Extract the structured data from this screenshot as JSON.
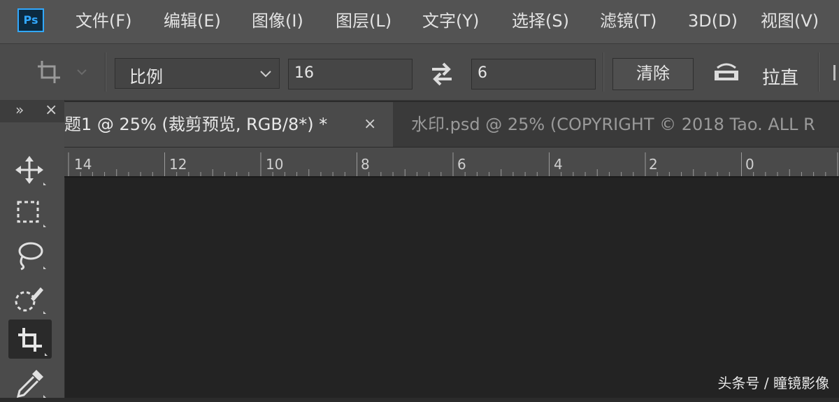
{
  "app": {
    "logo_text": "Ps",
    "accent": "#31a8ff"
  },
  "menu": {
    "items": [
      {
        "label": "文件(F)"
      },
      {
        "label": "编辑(E)"
      },
      {
        "label": "图像(I)"
      },
      {
        "label": "图层(L)"
      },
      {
        "label": "文字(Y)"
      },
      {
        "label": "选择(S)"
      },
      {
        "label": "滤镜(T)"
      },
      {
        "label": "3D(D)"
      },
      {
        "label": "视图(V)"
      }
    ]
  },
  "options": {
    "ratio_select": "比例",
    "width_value": "16",
    "height_value": "6",
    "clear_label": "清除",
    "straighten_label": "拉直"
  },
  "tabs": [
    {
      "label": "题1 @ 25% (裁剪预览, RGB/8*) *",
      "active": true,
      "close": "×"
    },
    {
      "label": "水印.psd @ 25% (COPYRIGHT © 2018 Tao. ALL R",
      "active": false
    }
  ],
  "ruler": {
    "labels": [
      "14",
      "12",
      "10",
      "8",
      "6",
      "4",
      "2",
      "0"
    ]
  },
  "toolbar": {
    "header_expand": "»",
    "header_close": "×",
    "tools": [
      "move-tool",
      "marquee-tool",
      "lasso-tool",
      "quick-selection-tool",
      "crop-tool",
      "eyedropper-tool"
    ]
  },
  "watermark": "头条号 / 瞳镜影像"
}
